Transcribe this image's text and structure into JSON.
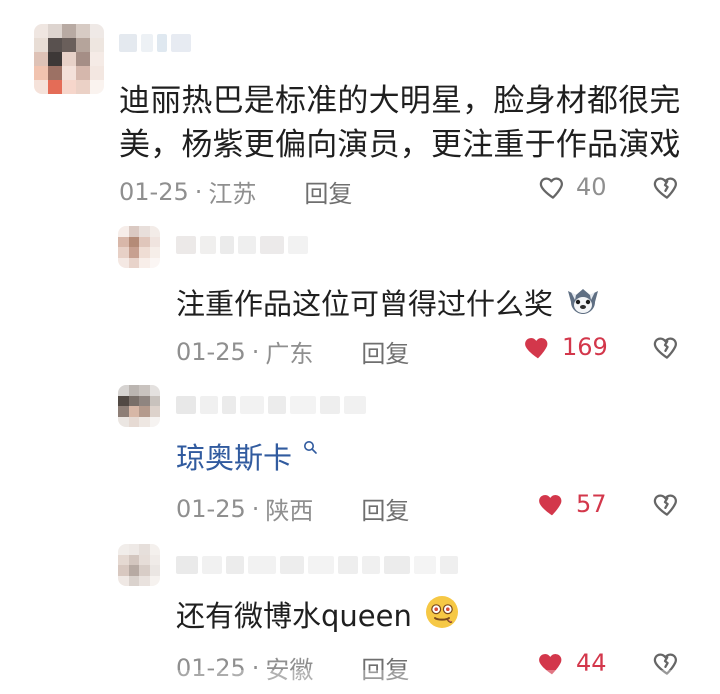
{
  "comments": [
    {
      "text_line1": "迪丽热巴是标准的大明星，脸身材都很完",
      "text_line2": "美，杨紫更偏向演员，更注重于作品演戏",
      "date": "01-25",
      "location": "江苏",
      "reply_label": "回复",
      "likes": "40"
    }
  ],
  "replies": [
    {
      "text": "注重作品这位可曾得过什么奖",
      "date": "01-25",
      "location": "广东",
      "reply_label": "回复",
      "likes": "169"
    },
    {
      "text": "琼奥斯卡",
      "date": "01-25",
      "location": "陕西",
      "reply_label": "回复",
      "likes": "57"
    },
    {
      "text": "还有微博水queen",
      "date": "01-25",
      "location": "安徽",
      "reply_label": "回复",
      "likes": "44"
    }
  ],
  "separator": "·",
  "icons": {
    "like": "heart-icon",
    "like_active": "heart-filled-icon",
    "dislike": "broken-heart-icon",
    "search": "search-icon",
    "emoji": "emoji-icon"
  },
  "colors": {
    "like_active": "#d3374b",
    "link": "#315b9f",
    "meta": "#8f8f8f"
  }
}
